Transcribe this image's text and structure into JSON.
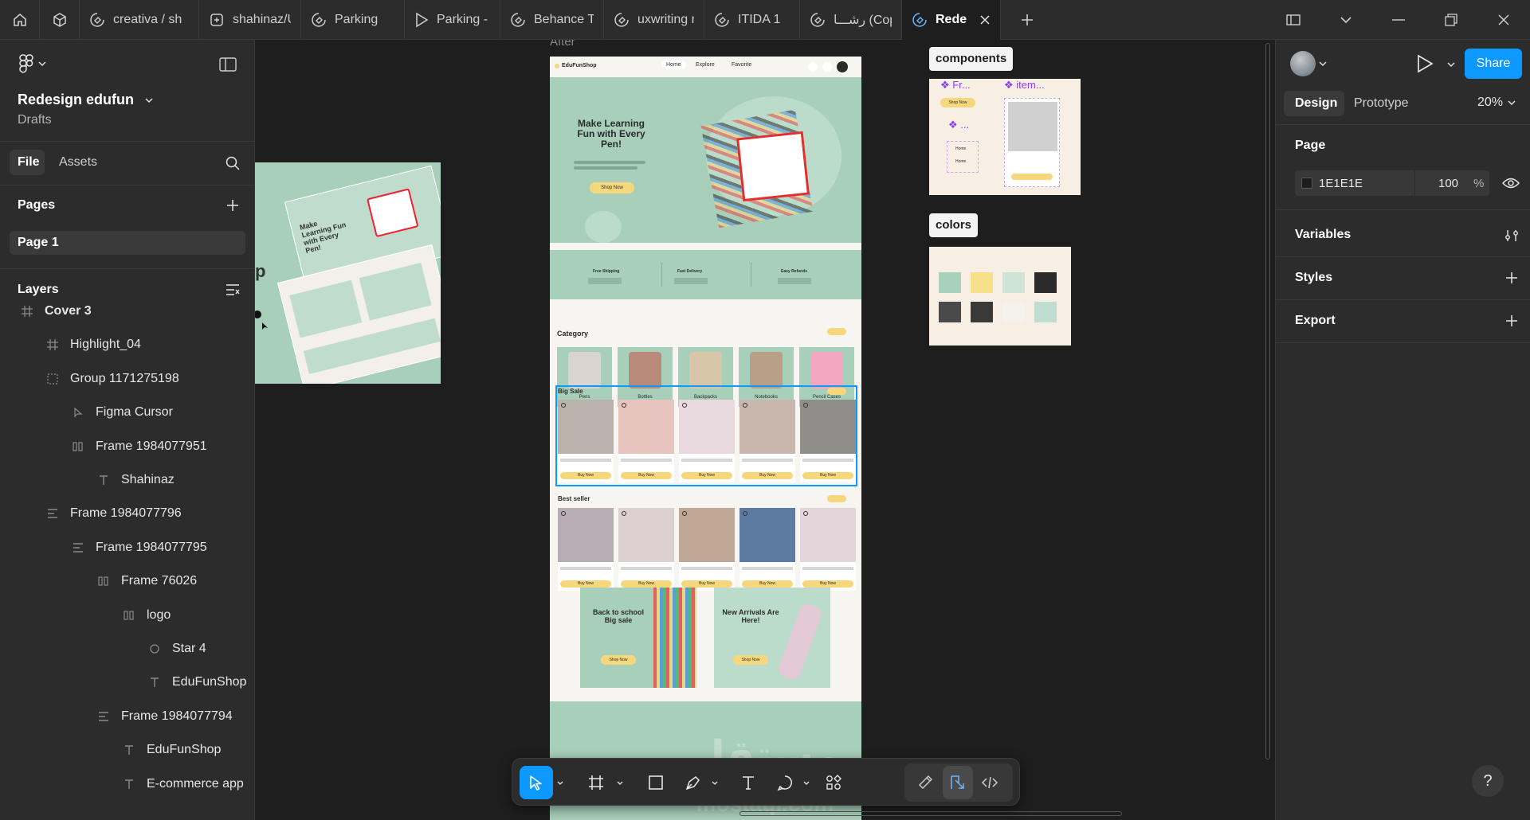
{
  "tabs": [
    {
      "label": "creativa / sh",
      "icon": "figma-draft-icon"
    },
    {
      "label": "shahinaz/UX",
      "icon": "figjam-icon"
    },
    {
      "label": "Parking",
      "icon": "figma-draft-icon"
    },
    {
      "label": "Parking - pr",
      "icon": "play-icon"
    },
    {
      "label": "Behance Te",
      "icon": "figma-draft-icon"
    },
    {
      "label": "uxwriting no",
      "icon": "figma-draft-icon"
    },
    {
      "label": "ITIDA 1",
      "icon": "figma-draft-icon"
    },
    {
      "label": "رشـــا (Copy",
      "icon": "figma-draft-icon"
    },
    {
      "label": "Redesig",
      "icon": "figma-draft-icon",
      "active": true
    }
  ],
  "file": {
    "name": "Redesign edufun",
    "location": "Drafts"
  },
  "left_tabs": {
    "file": "File",
    "assets": "Assets"
  },
  "pages": {
    "title": "Pages",
    "items": [
      "Page 1"
    ]
  },
  "layers": {
    "title": "Layers",
    "items": [
      {
        "label": "Cover 3",
        "icon": "frame-icon",
        "depth": 0
      },
      {
        "label": "Highlight_04",
        "icon": "frame-icon",
        "depth": 1
      },
      {
        "label": "Group 1171275198",
        "icon": "group-icon",
        "depth": 1
      },
      {
        "label": "Figma Cursor",
        "icon": "cursor-icon",
        "depth": 2
      },
      {
        "label": "Frame 1984077951",
        "icon": "autolayout-icon",
        "depth": 2
      },
      {
        "label": "Shahinaz",
        "icon": "text-icon",
        "depth": 3
      },
      {
        "label": "Frame 1984077796",
        "icon": "autolayout-v-icon",
        "depth": 1
      },
      {
        "label": "Frame 1984077795",
        "icon": "autolayout-v-icon",
        "depth": 2
      },
      {
        "label": "Frame 76026",
        "icon": "autolayout-icon",
        "depth": 3
      },
      {
        "label": "logo",
        "icon": "autolayout-icon",
        "depth": 4
      },
      {
        "label": "Star 4",
        "icon": "ellipse-icon",
        "depth": 5
      },
      {
        "label": "EduFunShop",
        "icon": "text-icon",
        "depth": 5
      },
      {
        "label": "Frame 1984077794",
        "icon": "autolayout-v-icon",
        "depth": 3
      },
      {
        "label": "EduFunShop",
        "icon": "text-icon",
        "depth": 4
      },
      {
        "label": "E-commerce app",
        "icon": "text-icon",
        "depth": 4
      }
    ]
  },
  "canvas": {
    "frame_label": "After",
    "cover_fragment": "p",
    "site": {
      "brand": "EduFunShop",
      "nav": [
        "Home",
        "Explore",
        "Favorite"
      ],
      "hero_title": "Make Learning Fun with Every Pen!",
      "hero_button": "Shop Now",
      "features": [
        "Free Shipping",
        "Fast Delivery",
        "Easy Refunds"
      ],
      "category_title": "Category",
      "categories": [
        "Pens",
        "Bottles",
        "Backpacks",
        "Notebooks",
        "Pencil Cases"
      ],
      "big_sale_title": "Big Sale",
      "best_seller_title": "Best seller",
      "buy_label": "Buy Now",
      "promo1": "Back to school Big sale",
      "promo2": "New Arrivals Are Here!",
      "promo_button": "Shop Now"
    },
    "components_label": "components",
    "comp_texts": {
      "a": "Fr...",
      "b": "item...",
      "c": "...",
      "shop": "Shop Now",
      "home1": "Home",
      "home2": "Home"
    },
    "colors_label": "colors",
    "swatches": [
      "#a8d0ba",
      "#f7e08a",
      "#cfe3d6",
      "#2b2b2b",
      "#4a4a4a",
      "#3a3a3a",
      "#f5f2ee",
      "#bfddd0"
    ],
    "watermark": [
      "مستقل",
      "mostaql.com"
    ]
  },
  "right": {
    "tabs": {
      "design": "Design",
      "prototype": "Prototype"
    },
    "zoom": "20%",
    "share": "Share",
    "page_title": "Page",
    "page_color": "1E1E1E",
    "page_opacity": "100",
    "percent": "%",
    "variables": "Variables",
    "styles": "Styles",
    "export": "Export",
    "help": "?"
  },
  "colors": {
    "accent": "#0d99ff",
    "panel": "#2c2c2c",
    "canvas": "#1e1e1e",
    "mint": "#a8d0ba",
    "yellow": "#f7d77b"
  }
}
